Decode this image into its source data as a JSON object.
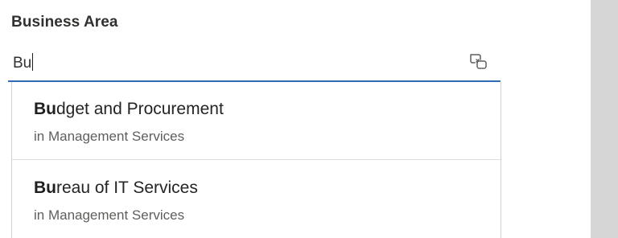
{
  "field": {
    "label": "Business Area",
    "value": "Bu"
  },
  "icons": {
    "clear": "clear-input-icon"
  },
  "suggestions": [
    {
      "match": "Bu",
      "rest": "dget and Procurement",
      "subtitle": "in Management Services"
    },
    {
      "match": "Bu",
      "rest": "reau of IT Services",
      "subtitle": "in Management Services"
    }
  ],
  "colors": {
    "accent_underline": "#2f6bb5",
    "scrollbar": "#d6d6d6"
  }
}
